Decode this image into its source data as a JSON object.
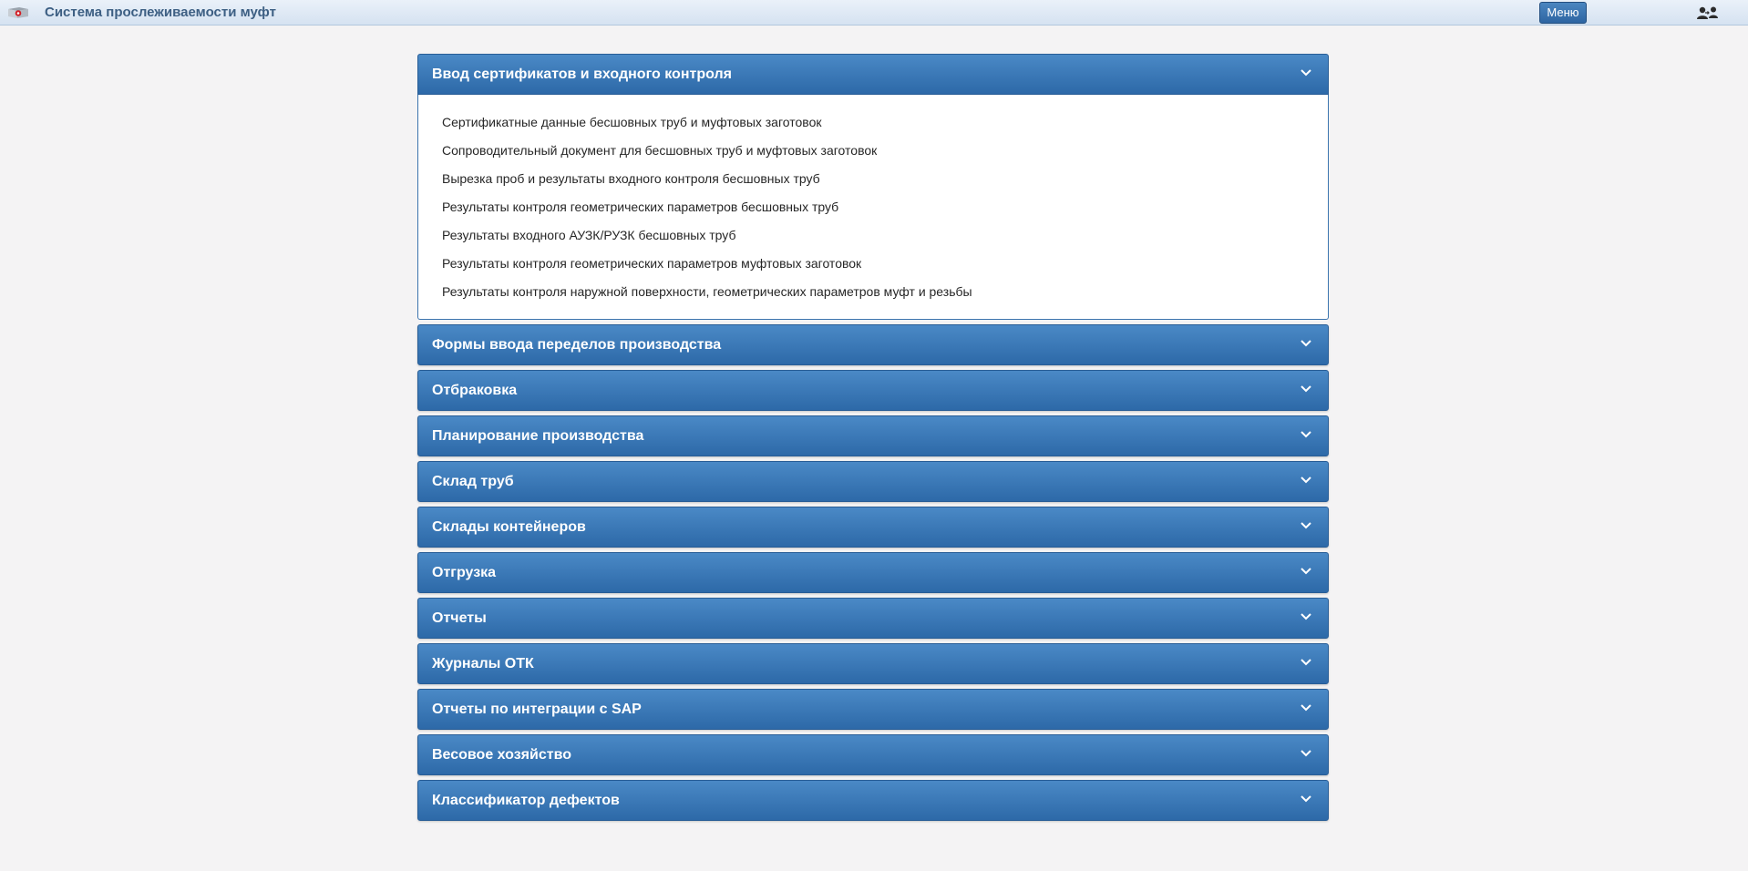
{
  "header": {
    "logo_icon": "app-logo-flag-icon",
    "title": "Система прослеживаемости муфт",
    "menu_label": "Меню",
    "user_icon": "users-switch-icon"
  },
  "colors": {
    "accent": "#3576b5",
    "header_bg": "#dfe8f3",
    "title_text": "#3d5f83",
    "page_bg": "#f4f3f4"
  },
  "sections": [
    {
      "title": "Ввод сертификатов и входного контроля",
      "expanded": true,
      "items": [
        "Сертификатные данные бесшовных труб и муфтовых заготовок",
        "Сопроводительный документ для бесшовных труб и муфтовых заготовок",
        "Вырезка проб и результаты входного контроля бесшовных труб",
        "Результаты контроля геометрических параметров бесшовных труб",
        "Результаты входного АУЗК/РУЗК бесшовных труб",
        "Результаты контроля геометрических параметров муфтовых заготовок",
        "Результаты контроля наружной поверхности, геометрических параметров муфт и резьбы"
      ]
    },
    {
      "title": "Формы ввода переделов производства",
      "expanded": false
    },
    {
      "title": "Отбраковка",
      "expanded": false
    },
    {
      "title": "Планирование производства",
      "expanded": false
    },
    {
      "title": "Склад труб",
      "expanded": false
    },
    {
      "title": "Склады контейнеров",
      "expanded": false
    },
    {
      "title": "Отгрузка",
      "expanded": false
    },
    {
      "title": "Отчеты",
      "expanded": false
    },
    {
      "title": "Журналы ОТК",
      "expanded": false
    },
    {
      "title": "Отчеты по интеграции с SAP",
      "expanded": false
    },
    {
      "title": "Весовое хозяйство",
      "expanded": false
    },
    {
      "title": "Классификатор дефектов",
      "expanded": false
    }
  ]
}
